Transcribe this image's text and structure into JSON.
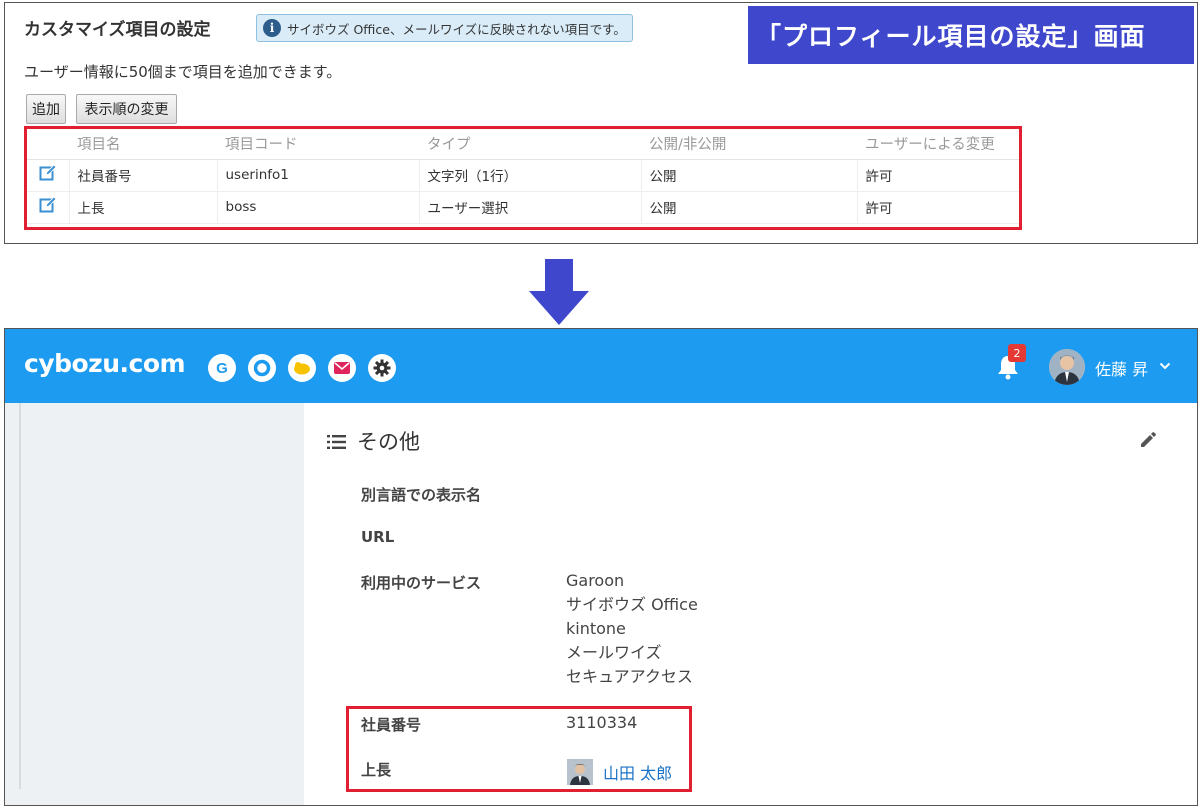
{
  "settings_panel": {
    "title": "カスタマイズ項目の設定",
    "info_text": "サイボウズ Office、メールワイズに反映されない項目です。",
    "description": "ユーザー情報に50個まで項目を追加できます。",
    "add_button": "追加",
    "order_button": "表示順の変更",
    "columns": [
      "項目名",
      "項目コード",
      "タイプ",
      "公開/非公開",
      "ユーザーによる変更"
    ],
    "rows": [
      {
        "name": "社員番号",
        "code": "userinfo1",
        "type": "文字列（1行）",
        "visibility": "公開",
        "user_change": "許可"
      },
      {
        "name": "上長",
        "code": "boss",
        "type": "ユーザー選択",
        "visibility": "公開",
        "user_change": "許可"
      }
    ]
  },
  "banner": {
    "text": "「プロフィール項目の設定」画面",
    "color": "#3f47cc"
  },
  "arrow": {
    "color": "#3f47cc"
  },
  "app": {
    "logo": "cybozu.com",
    "header_color": "#1d9bf0",
    "app_icons": [
      "garoon-icon",
      "office-icon",
      "kintone-icon",
      "mailwise-icon",
      "settings-gear-icon"
    ],
    "notification_count": "2",
    "user_name": "佐藤 昇"
  },
  "profile": {
    "section_title": "その他",
    "fields": {
      "alt_name_label": "別言語での表示名",
      "url_label": "URL",
      "services_label": "利用中のサービス",
      "services": [
        "Garoon",
        "サイボウズ Office",
        "kintone",
        "メールワイズ",
        "セキュアアクセス"
      ],
      "employee_no_label": "社員番号",
      "employee_no_value": "3110334",
      "boss_label": "上長",
      "boss_value": "山田 太郎"
    }
  },
  "highlight_color": "#e02030"
}
